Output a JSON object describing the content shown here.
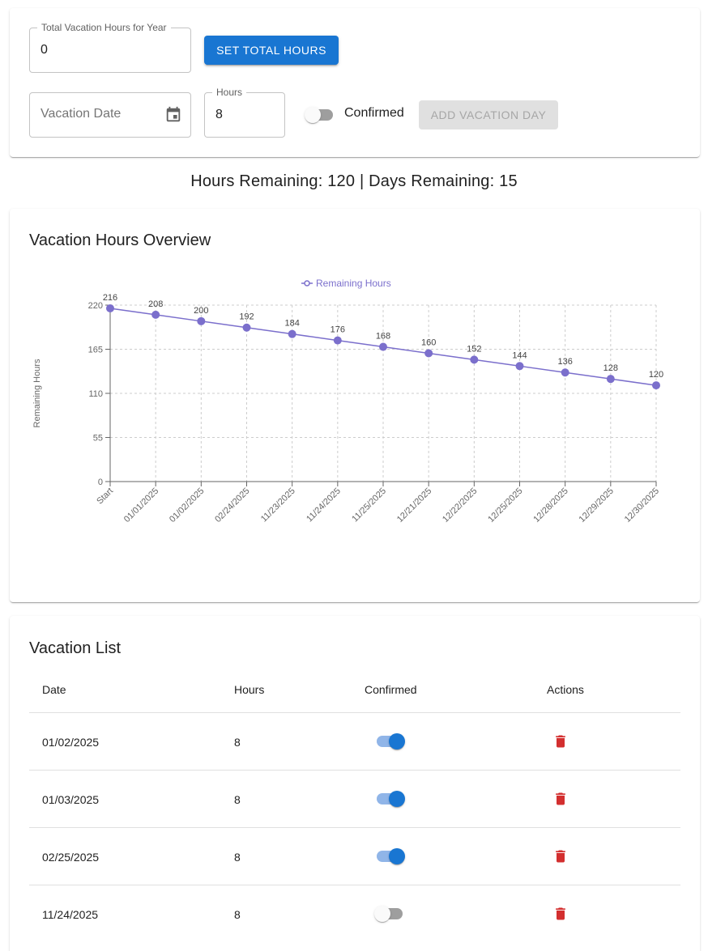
{
  "form": {
    "total_hours_label": "Total Vacation Hours for Year",
    "total_hours_value": "0",
    "set_total_button": "SET TOTAL HOURS",
    "vacation_date_placeholder": "Vacation Date",
    "hours_label": "Hours",
    "hours_value": "8",
    "confirmed_label": "Confirmed",
    "confirmed_on": false,
    "add_vacation_button": "ADD VACATION DAY"
  },
  "summary": "Hours Remaining: 120 | Days Remaining: 15",
  "chart_card": {
    "title": "Vacation Hours Overview"
  },
  "chart_data": {
    "type": "line",
    "ylabel": "Remaining Hours",
    "ylim": [
      0,
      220
    ],
    "yticks": [
      0,
      55,
      110,
      165,
      220
    ],
    "grid": true,
    "legend_position": "top",
    "categories": [
      "Start",
      "01/01/2025",
      "01/02/2025",
      "02/24/2025",
      "11/23/2025",
      "11/24/2025",
      "11/25/2025",
      "12/21/2025",
      "12/22/2025",
      "12/25/2025",
      "12/28/2025",
      "12/29/2025",
      "12/30/2025"
    ],
    "series": [
      {
        "name": "Remaining Hours",
        "color": "#7b6fcc",
        "values": [
          216,
          208,
          200,
          192,
          184,
          176,
          168,
          160,
          152,
          144,
          136,
          128,
          120
        ]
      }
    ]
  },
  "list": {
    "title": "Vacation List",
    "columns": [
      "Date",
      "Hours",
      "Confirmed",
      "Actions"
    ],
    "rows": [
      {
        "date": "01/02/2025",
        "hours": "8",
        "confirmed": true
      },
      {
        "date": "01/03/2025",
        "hours": "8",
        "confirmed": true
      },
      {
        "date": "02/25/2025",
        "hours": "8",
        "confirmed": true
      },
      {
        "date": "11/24/2025",
        "hours": "8",
        "confirmed": false
      }
    ]
  },
  "colors": {
    "primary": "#1976d2",
    "delete": "#d32f2f",
    "series": "#7b6fcc"
  },
  "icons": {
    "date_picker": "calendar-icon",
    "delete": "trash-icon"
  }
}
